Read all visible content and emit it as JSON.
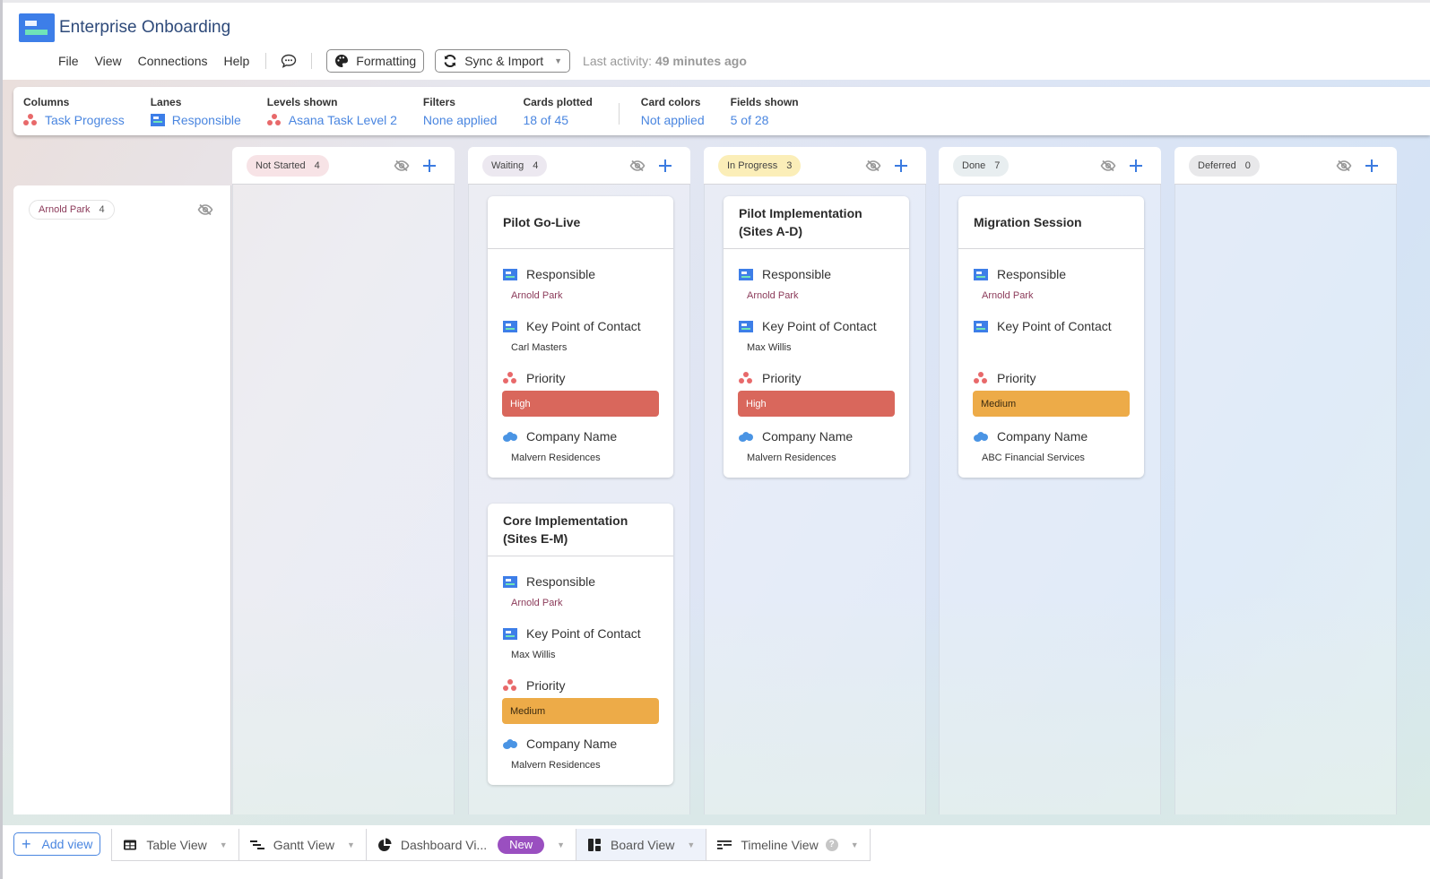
{
  "app": {
    "title": "Enterprise Onboarding"
  },
  "menu": {
    "items": [
      "File",
      "View",
      "Connections",
      "Help"
    ],
    "formatting_label": "Formatting",
    "sync_label": "Sync & Import",
    "last_activity_label": "Last activity:",
    "last_activity_value": "49 minutes ago"
  },
  "settings": {
    "columns": {
      "label": "Columns",
      "value": "Task Progress",
      "icon": "asana-icon"
    },
    "lanes": {
      "label": "Lanes",
      "value": "Responsible",
      "icon": "table-icon"
    },
    "levels": {
      "label": "Levels shown",
      "value": "Asana Task Level 2",
      "icon": "asana-icon"
    },
    "filters": {
      "label": "Filters",
      "value": "None applied"
    },
    "cards_plotted": {
      "label": "Cards plotted",
      "value": "18 of 45"
    },
    "card_colors": {
      "label": "Card colors",
      "value": "Not applied"
    },
    "fields_shown": {
      "label": "Fields shown",
      "value": "5 of 28"
    }
  },
  "lane": {
    "name": "Arnold Park",
    "count": "4"
  },
  "columns": [
    {
      "name": "Not Started",
      "count": "4",
      "pill_color": "#f7e3e6"
    },
    {
      "name": "Waiting",
      "count": "4",
      "pill_color": "#ece8f0"
    },
    {
      "name": "In Progress",
      "count": "3",
      "pill_color": "#fbeeb8"
    },
    {
      "name": "Done",
      "count": "7",
      "pill_color": "#e8eef0"
    },
    {
      "name": "Deferred",
      "count": "0",
      "pill_color": "#e8e8ea"
    }
  ],
  "field_labels": {
    "responsible": "Responsible",
    "key_contact": "Key Point of Contact",
    "priority": "Priority",
    "company": "Company Name"
  },
  "cards": {
    "waiting": [
      {
        "title": "Pilot Go-Live",
        "responsible": "Arnold Park",
        "key_contact": "Carl Masters",
        "priority": "High",
        "company": "Malvern Residences"
      },
      {
        "title": "Core Implementation (Sites E-M)",
        "responsible": "Arnold Park",
        "key_contact": "Max Willis",
        "priority": "Medium",
        "company": "Malvern Residences"
      }
    ],
    "in_progress": [
      {
        "title": "Pilot Implementation (Sites A-D)",
        "responsible": "Arnold Park",
        "key_contact": "Max Willis",
        "priority": "High",
        "company": "Malvern Residences"
      }
    ],
    "done": [
      {
        "title": "Migration Session",
        "responsible": "Arnold Park",
        "key_contact": "",
        "priority": "Medium",
        "company": "ABC Financial Services"
      }
    ]
  },
  "priority_colors": {
    "High": "#d9675c",
    "Medium": "#edab48"
  },
  "tabs": {
    "add_view": "Add view",
    "items": [
      {
        "label": "Table View",
        "icon": "table-grid-icon"
      },
      {
        "label": "Gantt View",
        "icon": "gantt-icon"
      },
      {
        "label": "Dashboard Vi...",
        "icon": "pie-chart-icon",
        "badge": "New"
      },
      {
        "label": "Board View",
        "icon": "board-icon",
        "active": true
      },
      {
        "label": "Timeline View",
        "icon": "timeline-icon"
      }
    ]
  }
}
